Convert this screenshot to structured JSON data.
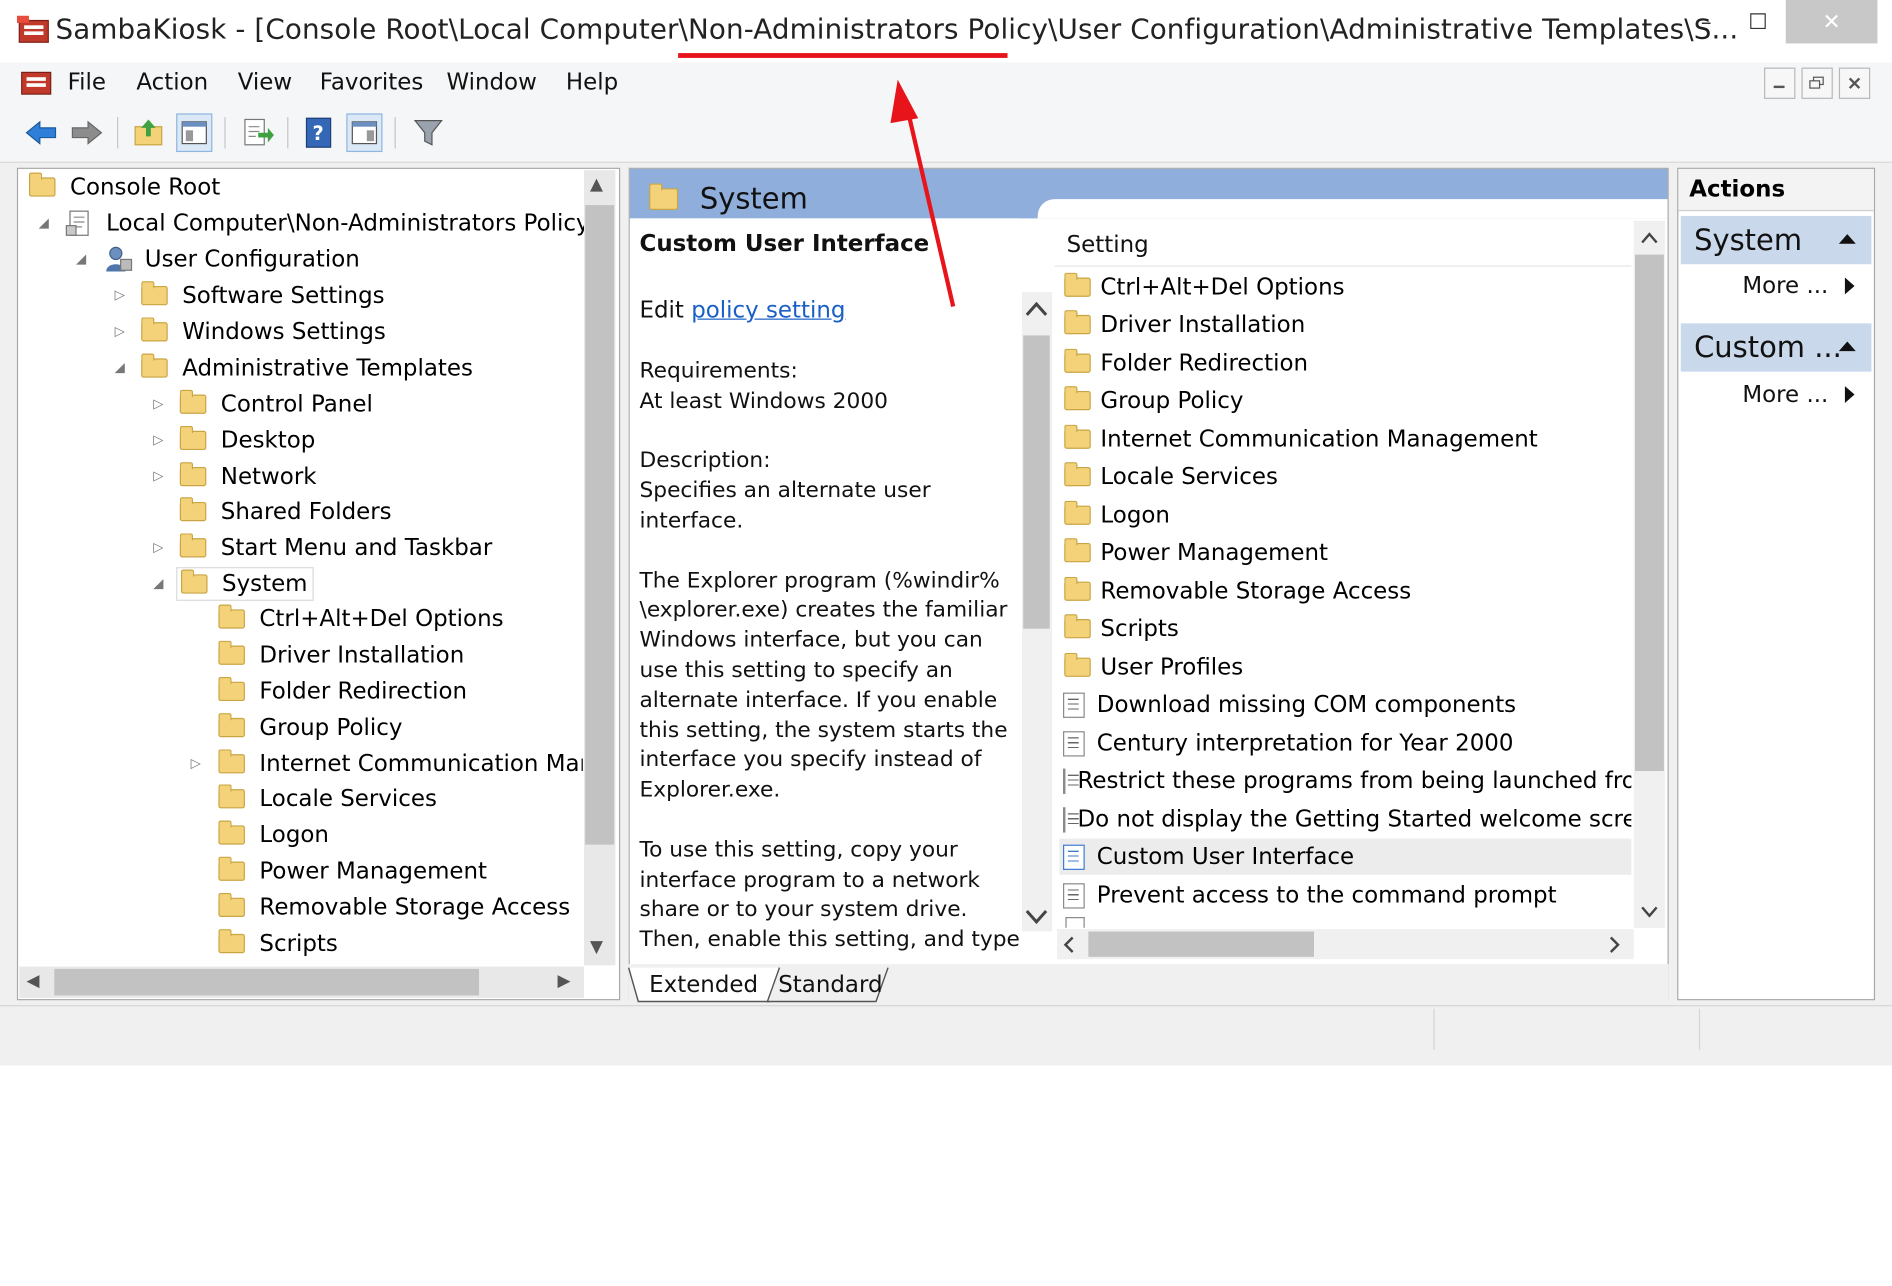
{
  "window": {
    "title": "SambaKiosk - [Console Root\\Local Computer\\Non-Administrators Policy\\User Configuration\\Administrative Templates\\S...",
    "minimize_glyph": "–",
    "maximize_glyph": "☐",
    "close_glyph": "✕"
  },
  "menu": {
    "items": [
      "File",
      "Action",
      "View",
      "Favorites",
      "Window",
      "Help"
    ]
  },
  "tree": {
    "rows": [
      {
        "label": "Console Root"
      },
      {
        "label": "Local Computer\\Non-Administrators Policy"
      },
      {
        "label": "User Configuration"
      },
      {
        "label": "Software Settings"
      },
      {
        "label": "Windows Settings"
      },
      {
        "label": "Administrative Templates"
      },
      {
        "label": "Control Panel"
      },
      {
        "label": "Desktop"
      },
      {
        "label": "Network"
      },
      {
        "label": "Shared Folders"
      },
      {
        "label": "Start Menu and Taskbar"
      },
      {
        "label": "System"
      },
      {
        "label": "Ctrl+Alt+Del Options"
      },
      {
        "label": "Driver Installation"
      },
      {
        "label": "Folder Redirection"
      },
      {
        "label": "Group Policy"
      },
      {
        "label": "Internet Communication Mana"
      },
      {
        "label": "Locale Services"
      },
      {
        "label": "Logon"
      },
      {
        "label": "Power Management"
      },
      {
        "label": "Removable Storage Access"
      },
      {
        "label": "Scripts"
      }
    ]
  },
  "main": {
    "header": "System",
    "description": {
      "title": "Custom User Interface",
      "edit_prefix": "Edit ",
      "edit_link": "policy setting",
      "lines": [
        "Requirements:",
        "At least Windows 2000",
        "",
        "Description:",
        "Specifies an alternate user",
        "interface.",
        "",
        "The Explorer program (%windir%",
        "\\explorer.exe) creates the familiar",
        "Windows interface, but you can",
        "use this setting to specify an",
        "alternate interface. If you enable",
        "this setting, the system starts the",
        "interface you specify instead of",
        "Explorer.exe.",
        "",
        "To use this setting, copy your",
        "interface program to a network",
        "share or to your system drive.",
        "Then, enable this setting, and type"
      ]
    },
    "list": {
      "column_header": "Setting",
      "rows": [
        {
          "label": "Ctrl+Alt+Del Options",
          "icon": "folder"
        },
        {
          "label": "Driver Installation",
          "icon": "folder"
        },
        {
          "label": "Folder Redirection",
          "icon": "folder"
        },
        {
          "label": "Group Policy",
          "icon": "folder"
        },
        {
          "label": "Internet Communication Management",
          "icon": "folder"
        },
        {
          "label": "Locale Services",
          "icon": "folder"
        },
        {
          "label": "Logon",
          "icon": "folder"
        },
        {
          "label": "Power Management",
          "icon": "folder"
        },
        {
          "label": "Removable Storage Access",
          "icon": "folder"
        },
        {
          "label": "Scripts",
          "icon": "folder"
        },
        {
          "label": "User Profiles",
          "icon": "folder"
        },
        {
          "label": "Download missing COM components",
          "icon": "setting"
        },
        {
          "label": "Century interpretation for Year 2000",
          "icon": "setting"
        },
        {
          "label": "Restrict these programs from being launched from",
          "icon": "setting"
        },
        {
          "label": "Do not display the Getting Started welcome screen",
          "icon": "setting"
        },
        {
          "label": "Custom User Interface",
          "icon": "setting",
          "selected": true
        },
        {
          "label": "Prevent access to the command prompt",
          "icon": "setting"
        }
      ]
    },
    "tabs": [
      "Extended",
      "Standard"
    ]
  },
  "actions": {
    "header": "Actions",
    "sections": [
      {
        "title": "System",
        "more": "More ..."
      },
      {
        "title": "Custom ...",
        "more": "More ..."
      }
    ]
  },
  "colors": {
    "annotation": "#e8141b",
    "selection": "#cce0f7",
    "section_bg": "#c9d8ea",
    "link": "#1a5fc6"
  }
}
